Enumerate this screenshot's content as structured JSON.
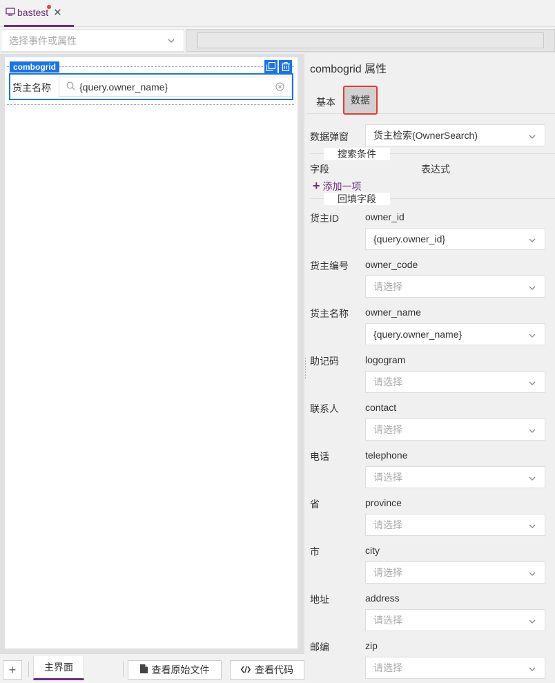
{
  "tab": {
    "title": "bastest"
  },
  "event_select": {
    "placeholder": "选择事件或属性"
  },
  "canvas": {
    "component_tag": "combogrid",
    "field_label": "货主名称",
    "field_value": "{query.owner_name}"
  },
  "bottom": {
    "main_tab": "主界面",
    "view_source": "查看原始文件",
    "view_code": "查看代码"
  },
  "props": {
    "title": "combogrid 属性",
    "tabs": {
      "basic": "基本",
      "data": "数据"
    },
    "popup_label": "数据弹窗",
    "popup_value": "货主检索(OwnerSearch)",
    "search_section": "搜索条件",
    "col_field": "字段",
    "col_expr": "表达式",
    "add_item": "添加一项",
    "fill_section": "回填字段",
    "rows": [
      {
        "label": "货主ID",
        "field": "owner_id",
        "value": "{query.owner_id}",
        "placeholder": ""
      },
      {
        "label": "货主编号",
        "field": "owner_code",
        "value": "",
        "placeholder": "请选择"
      },
      {
        "label": "货主名称",
        "field": "owner_name",
        "value": "{query.owner_name}",
        "placeholder": ""
      },
      {
        "label": "助记码",
        "field": "logogram",
        "value": "",
        "placeholder": "请选择"
      },
      {
        "label": "联系人",
        "field": "contact",
        "value": "",
        "placeholder": "请选择"
      },
      {
        "label": "电话",
        "field": "telephone",
        "value": "",
        "placeholder": "请选择"
      },
      {
        "label": "省",
        "field": "province",
        "value": "",
        "placeholder": "请选择"
      },
      {
        "label": "市",
        "field": "city",
        "value": "",
        "placeholder": "请选择"
      },
      {
        "label": "地址",
        "field": "address",
        "value": "",
        "placeholder": "请选择"
      },
      {
        "label": "邮编",
        "field": "zip",
        "value": "",
        "placeholder": "请选择"
      }
    ]
  },
  "colors": {
    "accent": "#6b2f7a",
    "selection": "#1a73e8",
    "highlight": "#e53935"
  }
}
